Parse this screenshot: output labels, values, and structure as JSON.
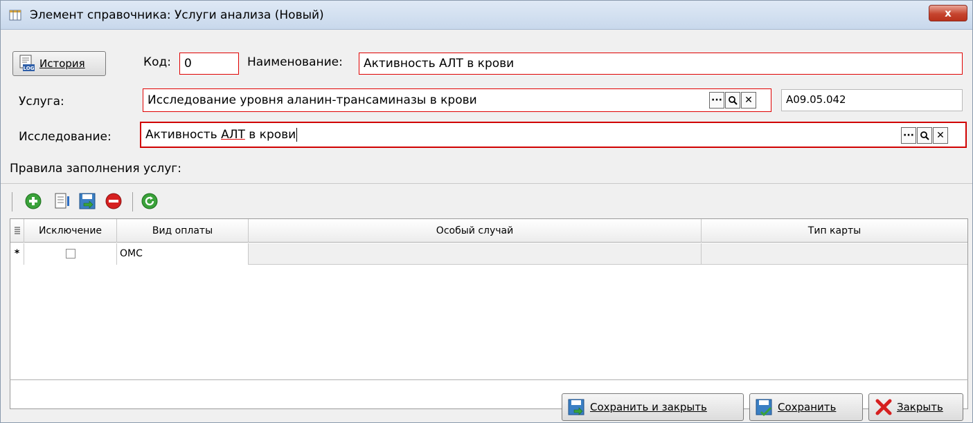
{
  "window": {
    "title": "Элемент справочника: Услуги анализа (Новый)",
    "close_label": "x"
  },
  "header": {
    "history_button_label": "История",
    "code_label": "Код:",
    "code_value": "0",
    "name_label": "Наименование:",
    "name_value": "Активность АЛТ в крови"
  },
  "service": {
    "label": "Услуга:",
    "value": "Исследование уровня аланин-трансаминазы в крови",
    "code": "A09.05.042"
  },
  "research": {
    "label": "Исследование:",
    "value_prefix": "Активность ",
    "value_underlined": "АЛТ",
    "value_suffix": " в крови"
  },
  "picker_buttons": {
    "browse": "···",
    "search": "search-icon",
    "clear": "✕"
  },
  "rules_section_label": "Правила заполнения услуг:",
  "toolbar": {
    "icons": [
      "add-icon",
      "edit-icon",
      "save-icon",
      "delete-icon",
      "refresh-icon"
    ]
  },
  "grid": {
    "columns": [
      "Исключение",
      "Вид оплаты",
      "Особый случай",
      "Тип карты"
    ],
    "rows": [
      {
        "marker": "*",
        "exclusion": false,
        "payment_type": "ОМС",
        "special_case": "",
        "card_type": ""
      }
    ]
  },
  "footer": {
    "save_close_label": "Сохранить и закрыть",
    "save_label": "Сохранить",
    "close_label": "Закрыть"
  },
  "colors": {
    "required_border": "#e00000",
    "titlebar": "#c8d8ec",
    "close_button": "#c6452f"
  }
}
